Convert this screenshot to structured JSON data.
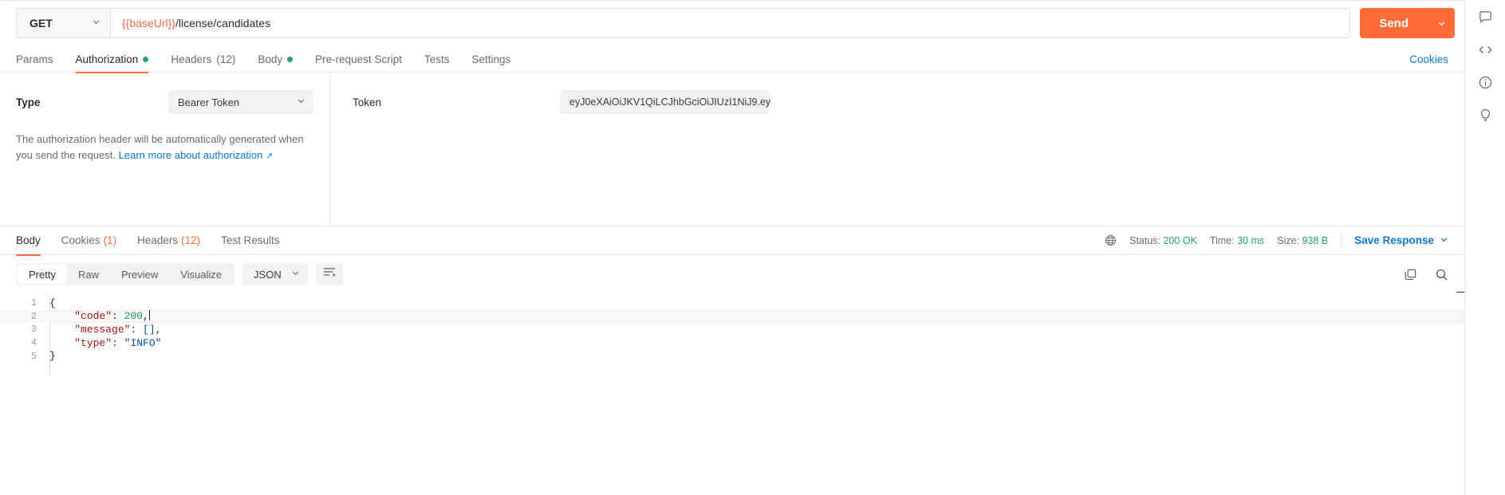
{
  "request": {
    "method": "GET",
    "method_caret": "chevron-down",
    "url_variable": "{{baseUrl}}",
    "url_path": "/license/candidates",
    "send_label": "Send",
    "tabs": [
      {
        "label": "Params",
        "dot": false,
        "count": "",
        "active": false
      },
      {
        "label": "Authorization",
        "dot": true,
        "count": "",
        "active": true
      },
      {
        "label": "Headers",
        "dot": false,
        "count": "(12)",
        "active": false
      },
      {
        "label": "Body",
        "dot": true,
        "count": "",
        "active": false
      },
      {
        "label": "Pre-request Script",
        "dot": false,
        "count": "",
        "active": false
      },
      {
        "label": "Tests",
        "dot": false,
        "count": "",
        "active": false
      },
      {
        "label": "Settings",
        "dot": false,
        "count": "",
        "active": false
      }
    ],
    "cookies_link": "Cookies"
  },
  "auth": {
    "type_label": "Type",
    "type_value": "Bearer Token",
    "help_text": "The authorization header will be automatically generated when you send the request.",
    "help_link": "Learn more about authorization",
    "help_link_arrow": "↗",
    "token_label": "Token",
    "token_value": "eyJ0eXAiOiJKV1QiLCJhbGciOiJIUzI1NiJ9.ey…"
  },
  "response": {
    "tabs": [
      {
        "label": "Body",
        "count": "",
        "active": true
      },
      {
        "label": "Cookies",
        "count": "(1)",
        "active": false
      },
      {
        "label": "Headers",
        "count": "(12)",
        "active": false
      },
      {
        "label": "Test Results",
        "count": "",
        "active": false
      }
    ],
    "status_label": "Status:",
    "status_value": "200 OK",
    "time_label": "Time:",
    "time_value": "30 ms",
    "size_label": "Size:",
    "size_value": "938 B",
    "save_response": "Save Response",
    "format_tabs": [
      {
        "label": "Pretty",
        "active": true
      },
      {
        "label": "Raw",
        "active": false
      },
      {
        "label": "Preview",
        "active": false
      },
      {
        "label": "Visualize",
        "active": false
      }
    ],
    "language": "JSON",
    "body_lines": [
      {
        "num": "1",
        "active": false,
        "tokens": [
          {
            "t": "{",
            "c": "k-pun"
          }
        ]
      },
      {
        "num": "2",
        "active": true,
        "tokens": [
          {
            "t": "    ",
            "c": "k-pun"
          },
          {
            "t": "\"code\"",
            "c": "k-key"
          },
          {
            "t": ": ",
            "c": "k-pun"
          },
          {
            "t": "200",
            "c": "k-num"
          },
          {
            "t": ",",
            "c": "k-pun"
          }
        ]
      },
      {
        "num": "3",
        "active": false,
        "tokens": [
          {
            "t": "    ",
            "c": "k-pun"
          },
          {
            "t": "\"message\"",
            "c": "k-key"
          },
          {
            "t": ": ",
            "c": "k-pun"
          },
          {
            "t": "[]",
            "c": "k-str"
          },
          {
            "t": ",",
            "c": "k-pun"
          }
        ]
      },
      {
        "num": "4",
        "active": false,
        "tokens": [
          {
            "t": "    ",
            "c": "k-pun"
          },
          {
            "t": "\"type\"",
            "c": "k-key"
          },
          {
            "t": ": ",
            "c": "k-pun"
          },
          {
            "t": "\"INFO\"",
            "c": "k-str"
          }
        ]
      },
      {
        "num": "5",
        "active": false,
        "tokens": [
          {
            "t": "}",
            "c": "k-pun"
          }
        ]
      }
    ]
  },
  "colors": {
    "accent": "#ff6c37",
    "link": "#0b79d0",
    "success": "#1ea672",
    "variable": "#ed6b44"
  }
}
